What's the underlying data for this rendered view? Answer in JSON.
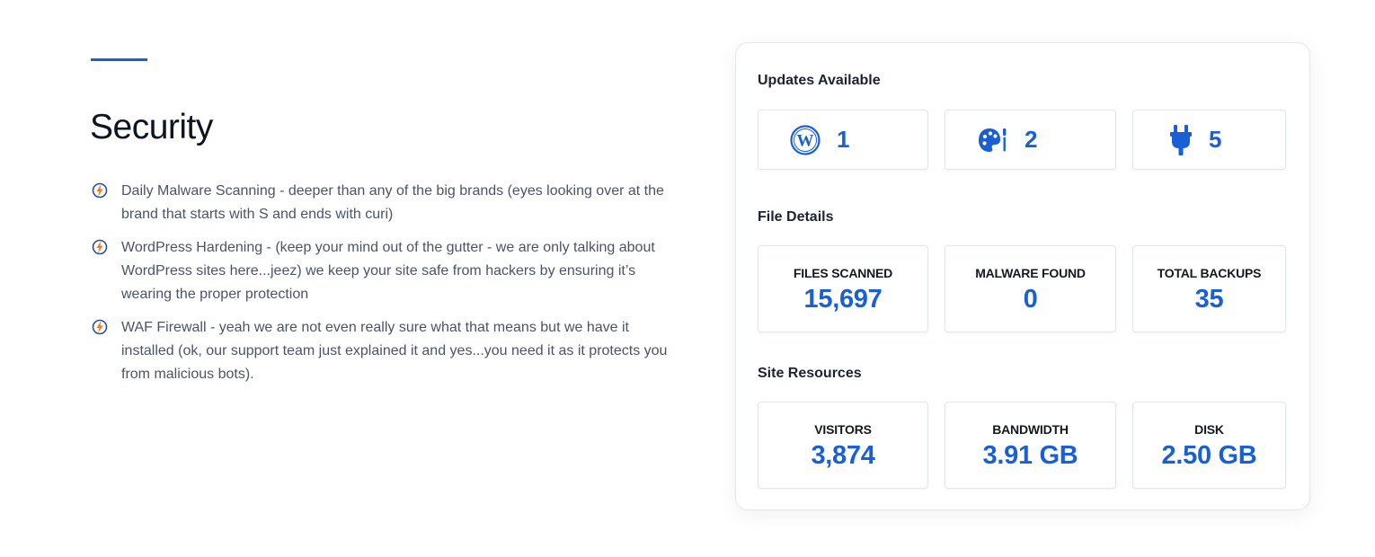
{
  "section": {
    "title": "Security",
    "accent_color": "#1a5fd4",
    "features": [
      {
        "icon": "bolt-circle-icon",
        "text": "Daily Malware Scanning - deeper than any of the big brands (eyes looking over at the brand that starts with S and ends with curi)"
      },
      {
        "icon": "bolt-circle-icon",
        "text": "WordPress Hardening - (keep your mind out of the gutter - we are only talking about WordPress sites here...jeez) we keep your site safe from hackers by ensuring it’s wearing the proper protection"
      },
      {
        "icon": "bolt-circle-icon",
        "text": "WAF Firewall - yeah we are not even really sure what that means but we have it installed (ok, our support team just explained it and yes...you need it as it protects you from malicious bots)."
      }
    ]
  },
  "dashboard": {
    "updates": {
      "title": "Updates Available",
      "items": [
        {
          "icon": "wordpress-icon",
          "count": "1"
        },
        {
          "icon": "palette-icon",
          "count": "2"
        },
        {
          "icon": "plug-icon",
          "count": "5"
        }
      ]
    },
    "file_details": {
      "title": "File Details",
      "stats": [
        {
          "label": "FILES SCANNED",
          "value": "15,697"
        },
        {
          "label": "MALWARE FOUND",
          "value": "0"
        },
        {
          "label": "TOTAL BACKUPS",
          "value": "35"
        }
      ]
    },
    "site_resources": {
      "title": "Site Resources",
      "stats": [
        {
          "label": "VISITORS",
          "value": "3,874"
        },
        {
          "label": "BANDWIDTH",
          "value": "3.91 GB"
        },
        {
          "label": "DISK",
          "value": "2.50 GB"
        }
      ]
    }
  }
}
